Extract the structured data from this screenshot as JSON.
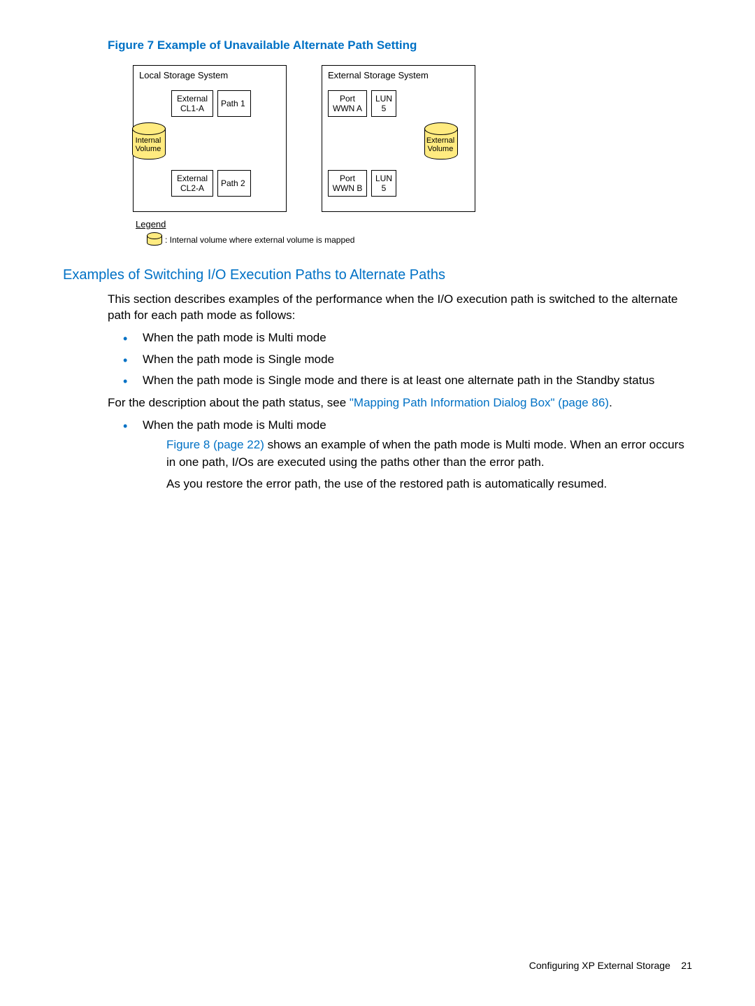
{
  "figure": {
    "caption": "Figure 7 Example of Unavailable Alternate Path Setting",
    "local_title": "Local Storage System",
    "external_title": "External Storage System",
    "local_rows": [
      {
        "port_label": "External\nCL1-A",
        "path_label": "Path 1"
      },
      {
        "port_label": "External\nCL2-A",
        "path_label": "Path 2"
      }
    ],
    "external_rows": [
      {
        "port_label": "Port\nWWN A",
        "lun_label": "LUN\n5"
      },
      {
        "port_label": "Port\nWWN B",
        "lun_label": "LUN\n5"
      }
    ],
    "internal_vol_label": "Internal\nVolume",
    "external_vol_label": "External\nVolume",
    "legend_title": "Legend",
    "legend_text": ": Internal volume where external volume is mapped"
  },
  "section": {
    "heading": "Examples of Switching I/O Execution Paths to Alternate Paths",
    "intro": "This section describes examples of the performance when the I/O execution path is switched to the alternate path for each path mode as follows:",
    "bullets_modes": [
      "When the path mode is Multi mode",
      "When the path mode is Single mode",
      "When the path mode is Single mode and there is at least one alternate path in the Standby status"
    ],
    "desc_prefix": "For the description about the path status, see ",
    "desc_link": "\"Mapping Path Information Dialog Box\" (page 86)",
    "desc_suffix": ".",
    "multi_item": "When the path mode is Multi mode",
    "multi_fig_link": "Figure 8 (page 22)",
    "multi_rest": " shows an example of when the path mode is Multi mode. When an error occurs in one path, I/Os are executed using the paths other than the error path.",
    "multi_restore": "As you restore the error path, the use of the restored path is automatically resumed."
  },
  "footer": {
    "title": "Configuring XP External Storage",
    "page": "21"
  }
}
